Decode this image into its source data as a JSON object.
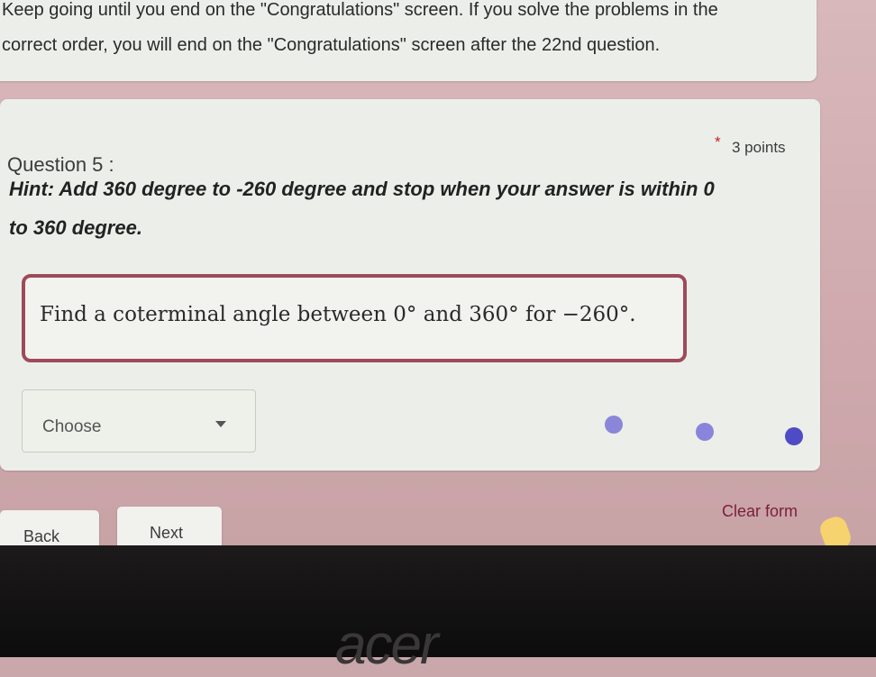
{
  "intro": {
    "line1": "Keep going until you end on the \"Congratulations\" screen. If you solve the problems in the",
    "line2": "correct order, you will end on the \"Congratulations\" screen after the 22nd question."
  },
  "question": {
    "title": "Question 5 :",
    "required_mark": "*",
    "points": "3 points",
    "hint_line1": "Hint: Add 360 degree to -260 degree and stop when your answer is within 0",
    "hint_line2": "to 360 degree.",
    "problem": "Find a coterminal angle between 0° and 360° for −260°.",
    "dropdown_selected": "Choose"
  },
  "buttons": {
    "back": "Back",
    "next": "Next",
    "clear_form": "Clear form"
  },
  "brand": {
    "logo": "acer"
  },
  "colors": {
    "accent": "#9e4a5b",
    "progress_dot": "#5b57c9",
    "clear_link": "#7a1f3a"
  }
}
